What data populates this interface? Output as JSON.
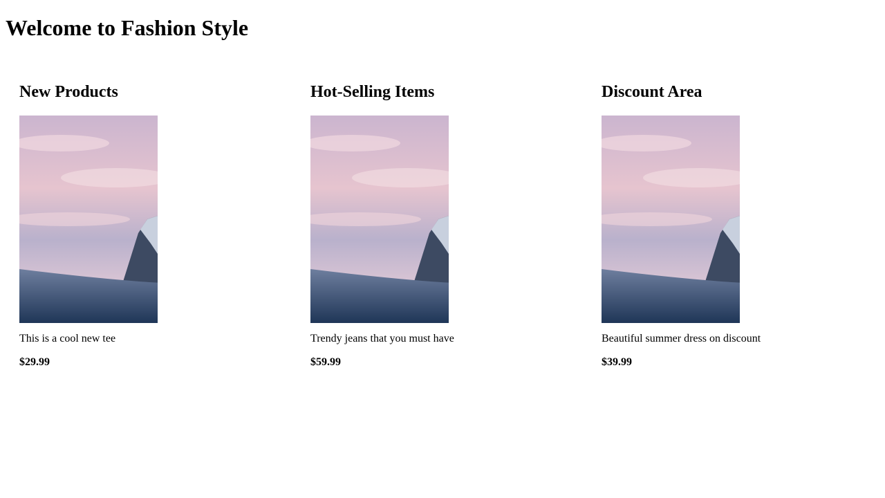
{
  "header": {
    "title": "Welcome to Fashion Style"
  },
  "sections": [
    {
      "heading": "New Products",
      "image_icon": "mountain-sunset-photo",
      "description": "This is a cool new tee",
      "price": "$29.99"
    },
    {
      "heading": "Hot-Selling Items",
      "image_icon": "mountain-sunset-photo",
      "description": "Trendy jeans that you must have",
      "price": "$59.99"
    },
    {
      "heading": "Discount Area",
      "image_icon": "mountain-sunset-photo",
      "description": "Beautiful summer dress on discount",
      "price": "$39.99"
    }
  ],
  "colors": {
    "sky_top": "#d9c3d3",
    "sky_mid": "#e8c7cd",
    "sky_haze": "#b7b2cc",
    "snow_dark": "#1f3657",
    "snow_light": "#6e7e9e"
  }
}
